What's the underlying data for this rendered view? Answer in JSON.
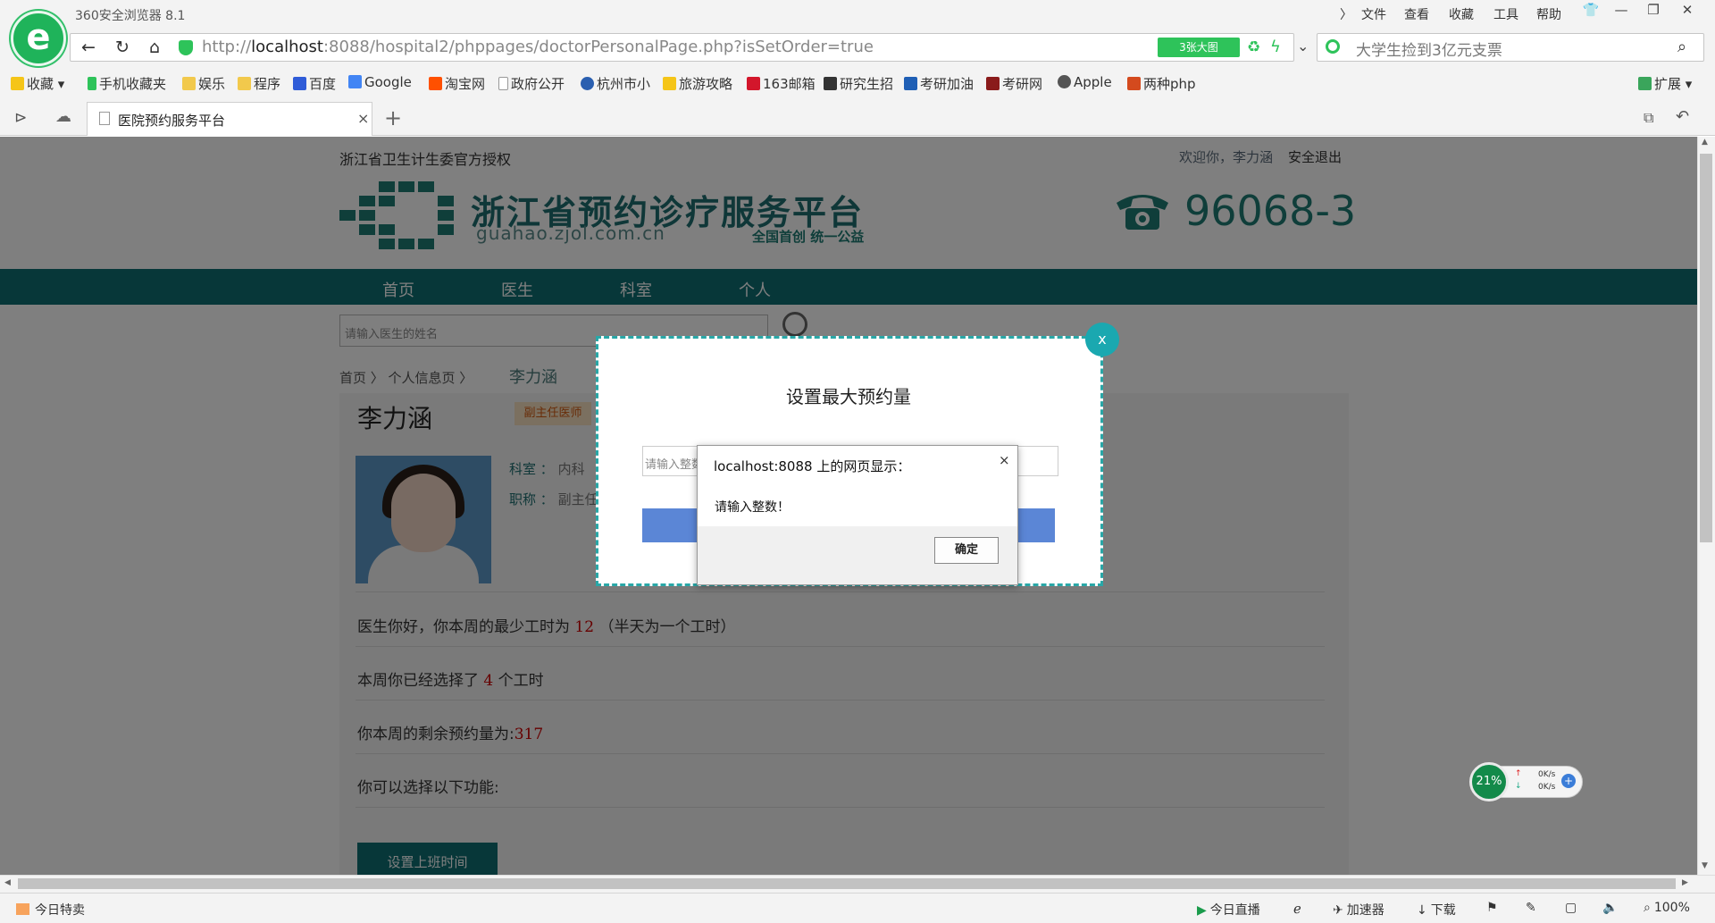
{
  "browser": {
    "app_name": "360安全浏览器 8.1",
    "menu": [
      "文件",
      "查看",
      "收藏",
      "工具",
      "帮助"
    ],
    "url_prefix": "http://",
    "url_host": "localhost",
    "url_rest": ":8088/hospital2/phppages/doctorPersonalPage.php?isSetOrder=true",
    "big_image_label": "3张大图",
    "search_text": "大学生捡到3亿元支票",
    "bookmarks": [
      "收藏",
      "手机收藏夹",
      "娱乐",
      "程序",
      "百度",
      "Google",
      "淘宝网",
      "政府公开",
      "杭州市小",
      "旅游攻略",
      "163邮箱",
      "研究生招",
      "考研加油",
      "考研网",
      "Apple",
      "两种php"
    ],
    "extensions_label": "扩展",
    "tab_title": "医院预约服务平台"
  },
  "header": {
    "authorization": "浙江省卫生计生委官方授权",
    "welcome": "欢迎你，李力涵",
    "logout": "安全退出",
    "site_title": "浙江省预约诊疗服务平台",
    "site_domain": "guahao.zjol.com.cn",
    "slogan": "全国首创  统一公益",
    "phone": "96068-3"
  },
  "nav": [
    "首页",
    "医生",
    "科室",
    "个人"
  ],
  "search": {
    "placeholder": "请输入医生的姓名"
  },
  "breadcrumb": {
    "items": "首页 〉 个人信息页 〉",
    "current": "李力涵"
  },
  "doctor": {
    "name": "李力涵",
    "title_badge": "副主任医师",
    "dept_label": "科室 ：",
    "dept_value": "内科",
    "rank_label": "职称 ：",
    "rank_value": "副主任"
  },
  "stats": {
    "line1_pre": "医生你好，你本周的最少工时为",
    "line1_val": "12",
    "line1_post": "（半天为一个工时）",
    "line2_pre": "本周你已经选择了",
    "line2_val": "4",
    "line2_post": "个工时",
    "line3_pre": "你本周的剩余预约量为:",
    "line3_val": "317",
    "line4": "你可以选择以下功能:"
  },
  "set_work_button": "设置上班时间",
  "modal": {
    "title": "设置最大预约量",
    "input_placeholder": "请输入整数",
    "close": "x"
  },
  "alert": {
    "title": "localhost:8088 上的网页显示：",
    "message": "请输入整数！",
    "ok": "确定",
    "close": "×"
  },
  "statusbar": {
    "left": "今日特卖",
    "live": "今日直播",
    "accelerator": "加速器",
    "download": "下载",
    "zoom": "100%"
  },
  "speed_widget": {
    "percent": "21%",
    "up": "0K/s",
    "down": "0K/s"
  },
  "colors": {
    "brand": "#0f6e73",
    "modal_border": "#29a7a7",
    "modal_button": "#5b86d6"
  }
}
